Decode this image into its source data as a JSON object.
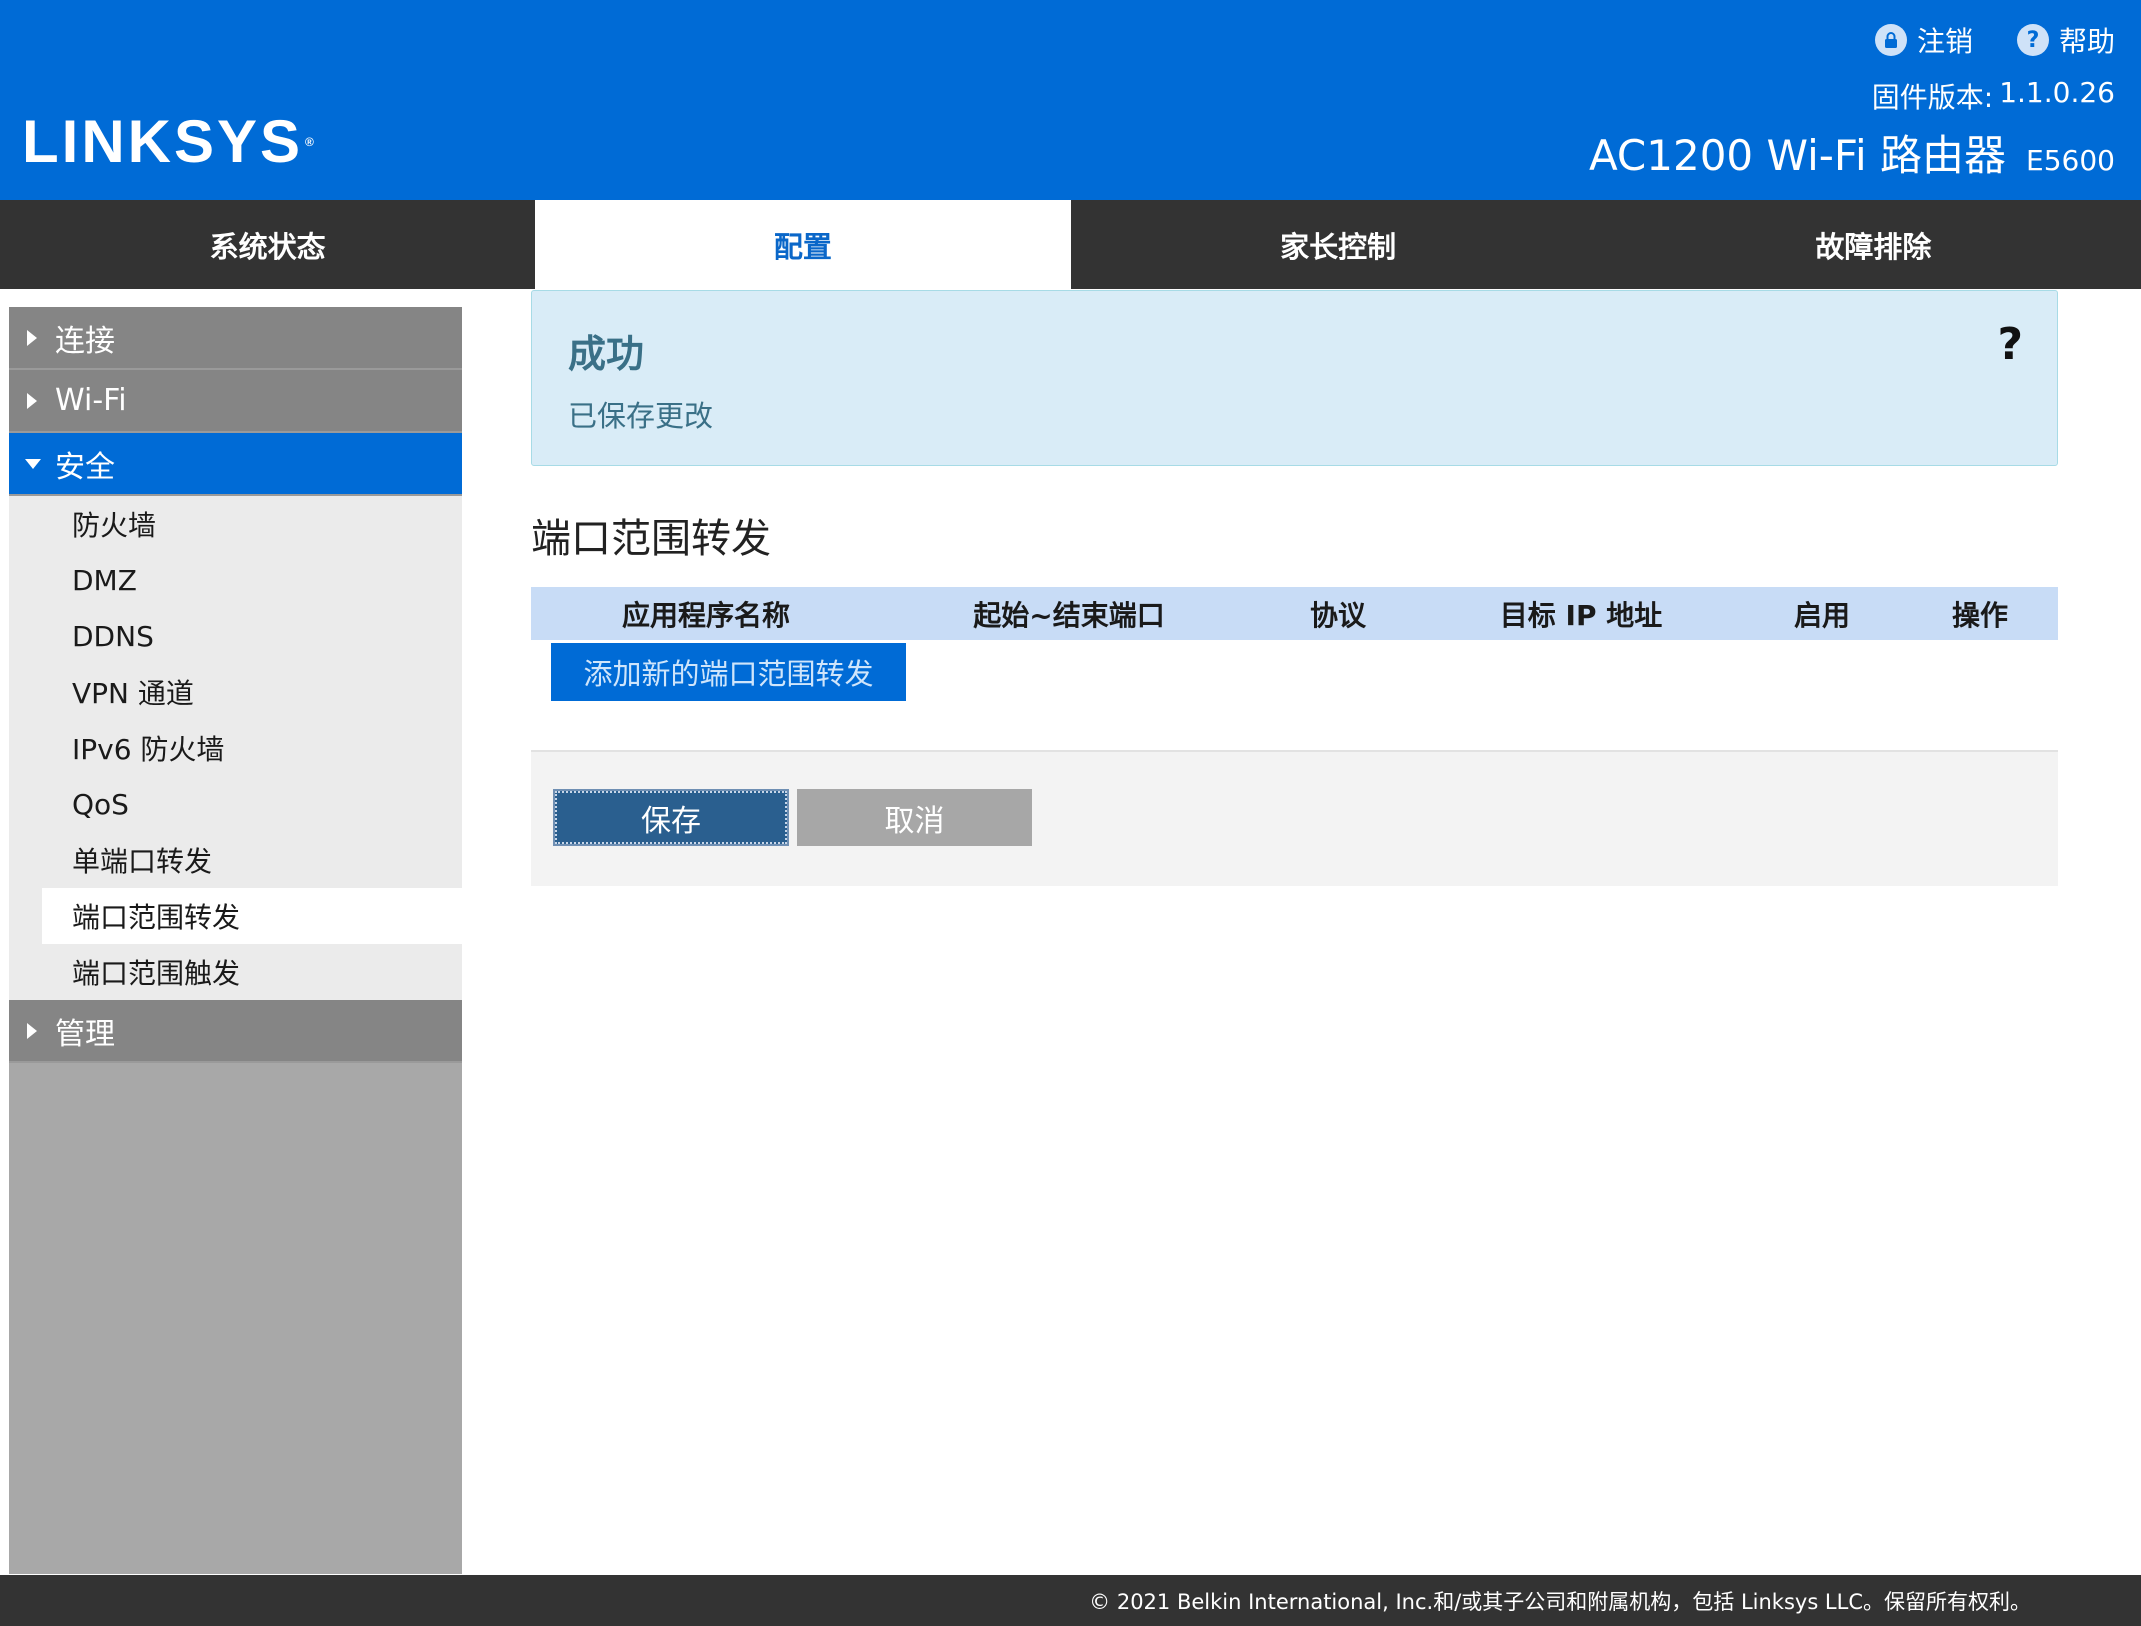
{
  "header": {
    "logo": "LINKSYS",
    "logo_mark": "®",
    "logout_label": "注销",
    "logout_icon": "lock-icon",
    "help_label": "帮助",
    "help_icon": "question-circle-icon",
    "firmware_label": "固件版本:",
    "firmware_version": "1.1.0.26",
    "model_name": "AC1200 Wi-Fi 路由器",
    "model_code": "E5600"
  },
  "topnav": {
    "tabs": [
      {
        "label": "系统状态"
      },
      {
        "label": "配置",
        "active": true
      },
      {
        "label": "家长控制"
      },
      {
        "label": "故障排除"
      }
    ]
  },
  "sidebar": {
    "sections": [
      {
        "label": "连接"
      },
      {
        "label": "Wi-Fi"
      },
      {
        "label": "安全",
        "open": true
      },
      {
        "label": "管理"
      }
    ],
    "security_items": [
      "防火墙",
      "DMZ",
      "DDNS",
      "VPN 通道",
      "IPv6 防火墙",
      "QoS",
      "单端口转发",
      "端口范围转发",
      "端口范围触发"
    ],
    "active_item": "端口范围转发"
  },
  "notice": {
    "title": "成功",
    "message": "已保存更改",
    "help": "?"
  },
  "main": {
    "title": "端口范围转发",
    "columns": [
      "应用程序名称",
      "起始~结束端口",
      "协议",
      "目标 IP 地址",
      "启用",
      "操作"
    ],
    "add_button": "添加新的端口范围转发",
    "save_button": "保存",
    "cancel_button": "取消"
  },
  "footer": {
    "copyright": "© 2021 Belkin International, Inc.和/或其子公司和附属机构，包括 Linksys LLC。保留所有权利。"
  },
  "colors": {
    "header_bg": "#006bd6",
    "nav_bg": "#333333",
    "sidebar_bg": "#a8a8a8",
    "sidebar_header_bg": "#858585",
    "notice_bg": "#d9ecf7",
    "table_header_bg": "#c8dcf6",
    "save_bg": "#2a5f8f",
    "cancel_bg": "#a7a7a7"
  }
}
